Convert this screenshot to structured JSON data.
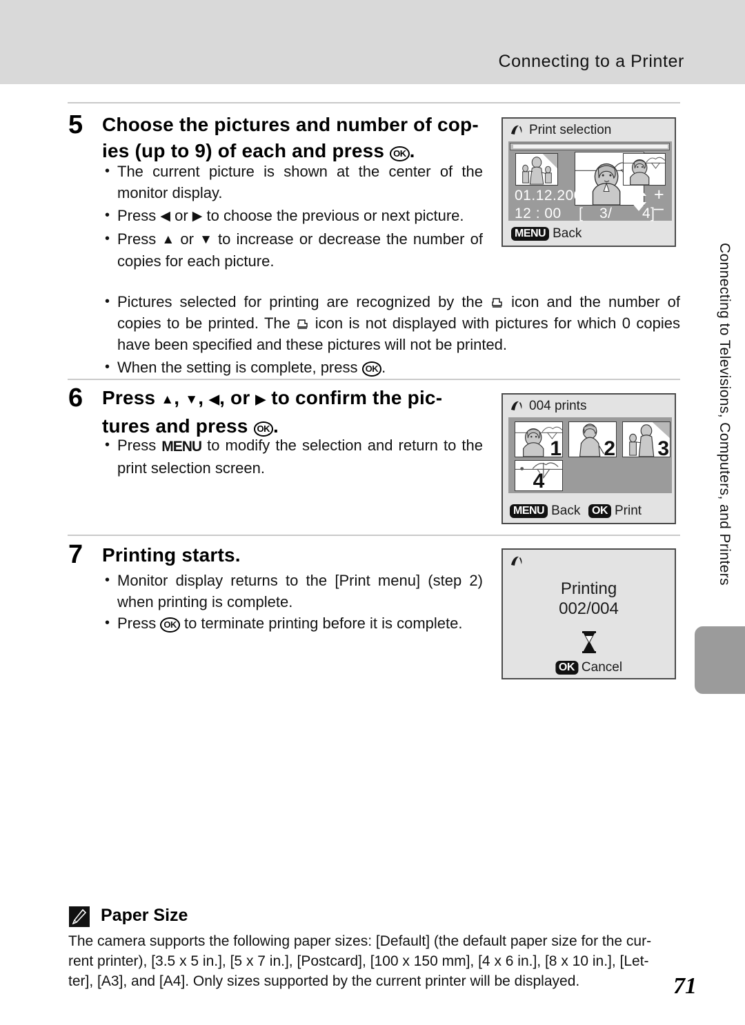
{
  "header": {
    "title": "Connecting to a Printer"
  },
  "sidebar": {
    "tab_label": "Connecting to Televisions, Computers, and Printers"
  },
  "page_number": "71",
  "steps": [
    {
      "number": "5",
      "heading_line1": "Choose the pictures and number of cop-",
      "heading_line2_a": "ies (up to 9) of each and press ",
      "heading_ok": "OK",
      "heading_line2_b": ".",
      "bullets": [
        {
          "text": "The current picture is shown at the center of the monitor display."
        },
        {
          "pre": "Press ",
          "mid": " or ",
          "post": " to choose the previous or next picture.",
          "left_arrow": "◀",
          "right_arrow": "▶"
        },
        {
          "pre": "Press ",
          "mid": " or ",
          "post": " to increase or decrease the number of copies for each picture.",
          "up_arrow": "▲",
          "down_arrow": "▼"
        },
        {
          "text": "Pictures selected for printing are recognized by the [printer] icon and the number of copies to be printed. The [printer] icon is not displayed with pictures for which 0 copies have been specified and these pictures will not be printed."
        },
        {
          "pre": "When the setting is complete, press ",
          "post": "."
        }
      ]
    },
    {
      "number": "6",
      "heading_pre": "Press ",
      "heading_arrows": [
        "▲",
        "▼",
        "◀",
        "▶"
      ],
      "heading_mid": " to confirm the pic-",
      "heading_line2": "tures and press ",
      "bullets": [
        {
          "pre": "Press ",
          "menu": "MENU",
          "post": " to modify the selection and return to the print selection screen."
        }
      ]
    },
    {
      "number": "7",
      "heading": "Printing starts.",
      "bullets": [
        {
          "text": "Monitor display returns to the [Print menu] (step 2) when printing is complete."
        },
        {
          "pre": "Press ",
          "post": " to terminate printing before it is complete."
        }
      ]
    }
  ],
  "screens": {
    "print_selection": {
      "title": "Print selection",
      "date": "01.12.2006",
      "time": "12 : 00",
      "counter_open": "[",
      "counter_current": "3/",
      "counter_total": "4]",
      "plus": "+",
      "minus": "–",
      "menu_badge": "MENU",
      "menu_action": "Back"
    },
    "prints_overview": {
      "title": "004 prints",
      "copies": [
        "1",
        "2",
        "3",
        "4"
      ],
      "menu_badge": "MENU",
      "menu_action": "Back",
      "ok_badge": "OK",
      "ok_action": "Print"
    },
    "printing": {
      "status": "Printing",
      "progress": "002/004",
      "ok_badge": "OK",
      "ok_action": "Cancel"
    }
  },
  "note": {
    "title": "Paper Size",
    "line1": "The camera supports the following paper sizes: [Default] (the default paper size for the cur-",
    "line2": "rent printer), [3.5 x 5 in.], [5 x 7 in.], [Postcard], [100 x 150 mm], [4 x 6 in.], [8 x 10 in.], [Let-",
    "line3": "ter], [A3], and [A4]. Only sizes supported by the current printer will be displayed."
  }
}
